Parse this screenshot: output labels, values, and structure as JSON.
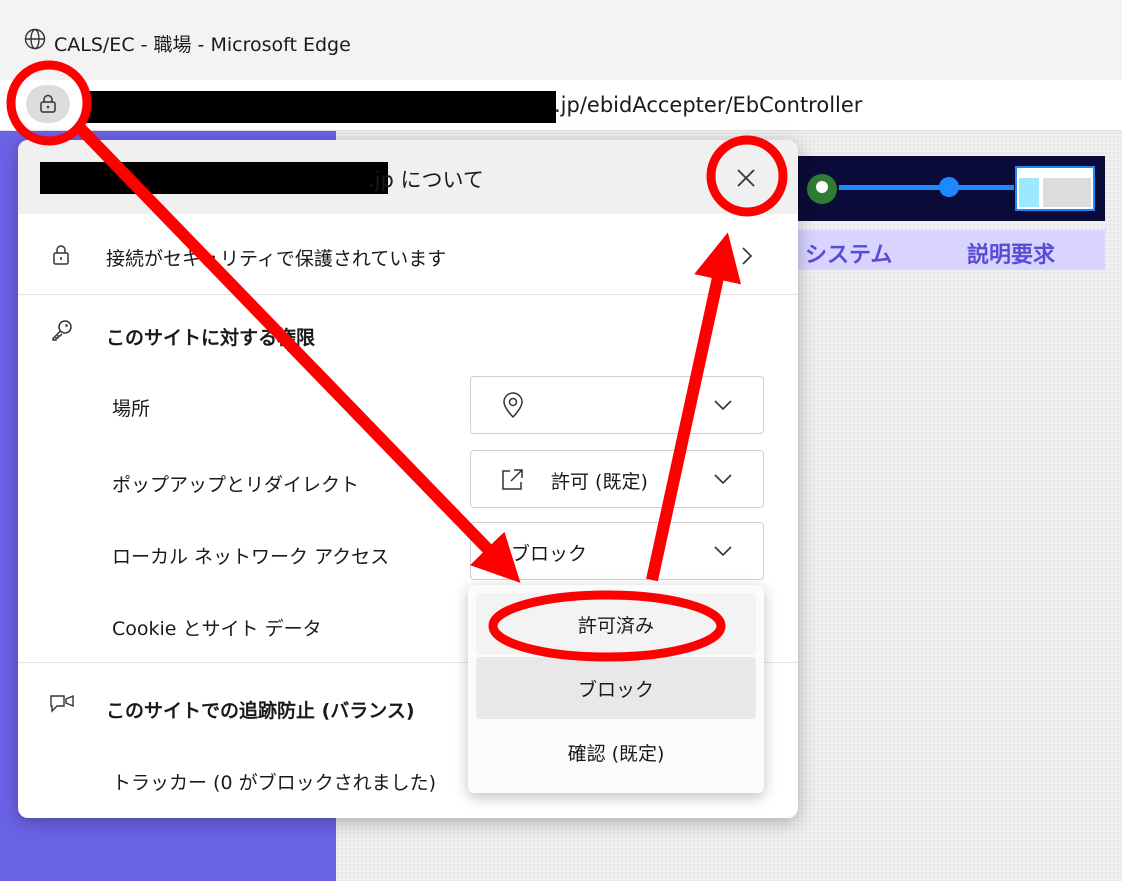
{
  "window": {
    "title": "CALS/EC - 職場 - Microsoft Edge"
  },
  "address_bar": {
    "url_suffix": ".jp/ebidAccepter/EbController"
  },
  "website": {
    "nav_items": [
      "システム",
      "説明要求"
    ]
  },
  "site_info": {
    "title_suffix": ".jp について",
    "connection": {
      "label": "接続がセキュリティで保護されています"
    },
    "permissions": {
      "heading": "このサイトに対する権限",
      "items": [
        {
          "label": "場所",
          "value": ""
        },
        {
          "label": "ポップアップとリダイレクト",
          "value": "許可 (既定)"
        },
        {
          "label": "ローカル ネットワーク アクセス",
          "value": "ブロック"
        },
        {
          "label": "Cookie とサイト データ",
          "value": ""
        }
      ]
    },
    "tracking": {
      "heading": "このサイトでの追跡防止 (バランス)",
      "trackers": "トラッカー (0 がブロックされました)"
    }
  },
  "dropdown": {
    "options": [
      {
        "label": "許可済み",
        "state": "highlighted"
      },
      {
        "label": "ブロック",
        "state": "selected"
      },
      {
        "label": "確認 (既定)",
        "state": "normal"
      }
    ]
  },
  "annotation_color": "#ff0000"
}
